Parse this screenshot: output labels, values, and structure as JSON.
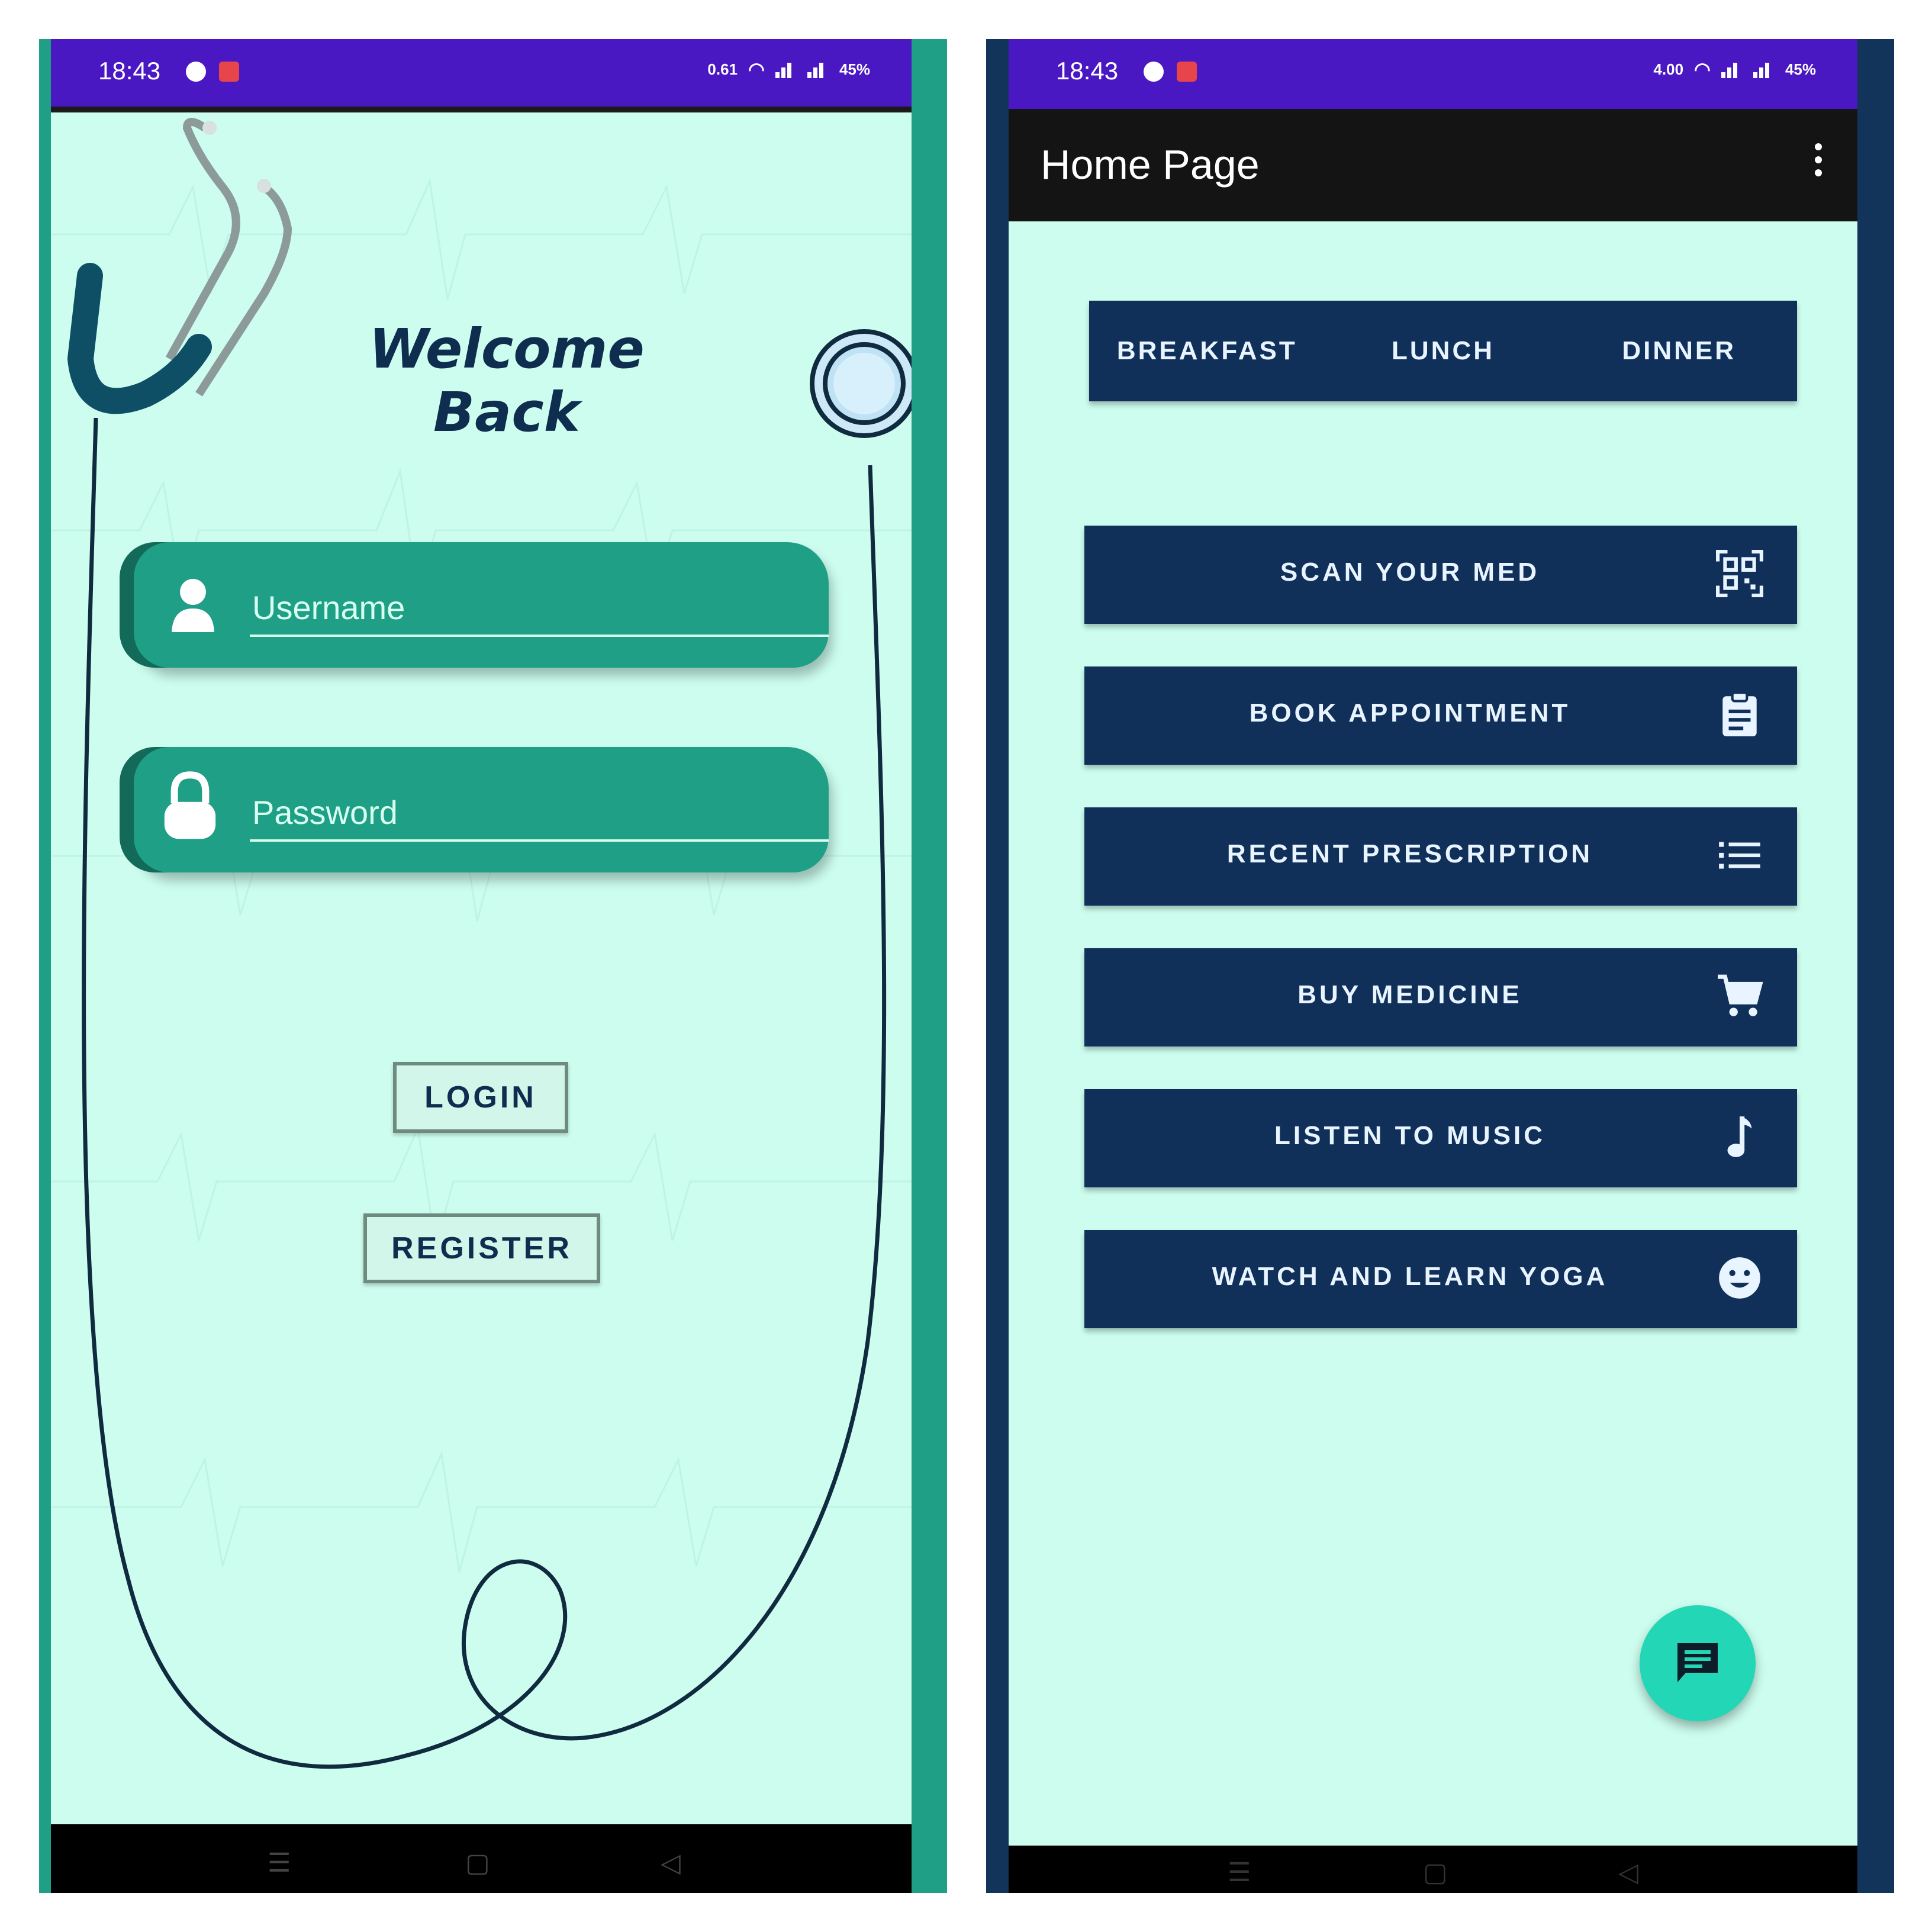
{
  "left_screen": {
    "status_bar": {
      "time": "18:43",
      "net_speed": "0.61",
      "battery": "45%"
    },
    "welcome_title": "Welcome Back",
    "username": {
      "placeholder": "Username"
    },
    "password": {
      "placeholder": "Password"
    },
    "login_label": "LOGIN",
    "register_label": "REGISTER",
    "colors": {
      "background": "#ccfdee",
      "field": "#1e9f86",
      "title": "#0f2d4f",
      "status_bar": "#4a18c3"
    }
  },
  "right_screen": {
    "status_bar": {
      "time": "18:43",
      "net_speed": "4.00",
      "battery": "45%"
    },
    "toolbar_title": "Home Page",
    "tabs": [
      {
        "label": "BREAKFAST"
      },
      {
        "label": "LUNCH"
      },
      {
        "label": "DINNER"
      }
    ],
    "menu": [
      {
        "label": "SCAN YOUR MED",
        "icon": "qr-scan-icon"
      },
      {
        "label": "BOOK APPOINTMENT",
        "icon": "clipboard-icon"
      },
      {
        "label": "RECENT PRESCRIPTION",
        "icon": "list-icon"
      },
      {
        "label": "BUY MEDICINE",
        "icon": "cart-icon"
      },
      {
        "label": "LISTEN TO MUSIC",
        "icon": "music-note-icon"
      },
      {
        "label": "WATCH AND LEARN YOGA",
        "icon": "smiley-icon"
      }
    ],
    "fab_icon": "chat-icon",
    "colors": {
      "button": "#10305a",
      "fab": "#22d6b6",
      "background": "#ccfdee"
    }
  }
}
